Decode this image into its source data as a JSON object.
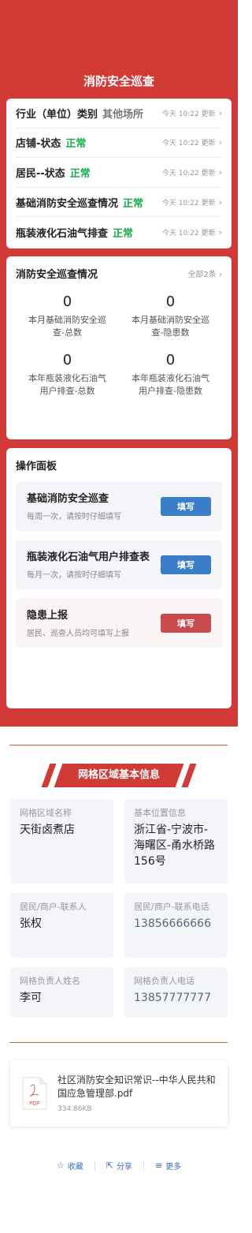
{
  "page_title": "消防安全巡查",
  "status_rows": [
    {
      "label": "行业（单位）类别",
      "value": "其他场所",
      "value_color": "gray",
      "updated": "今天 10:22 更新"
    },
    {
      "label": "店铺-状态",
      "value": "正常",
      "value_color": "green",
      "updated": "今天 10:22 更新"
    },
    {
      "label": "居民--状态",
      "value": "正常",
      "value_color": "green",
      "updated": "今天 10:22 更新"
    },
    {
      "label": "基础消防安全巡查情况",
      "value": "正常",
      "value_color": "green",
      "updated": "今天 10:22 更新"
    },
    {
      "label": "瓶装液化石油气排查",
      "value": "正常",
      "value_color": "green",
      "updated": "今天 10:22 更新"
    }
  ],
  "patrol": {
    "title": "消防安全巡查情况",
    "more": "全部2条",
    "stats": [
      {
        "value": "0",
        "label": "本月基础消防安全巡查-总数"
      },
      {
        "value": "0",
        "label": "本月基础消防安全巡查-隐患数"
      },
      {
        "value": "0",
        "label": "本年瓶装液化石油气用户排查-总数"
      },
      {
        "value": "0",
        "label": "本年瓶装液化石油气用户排查-隐患数"
      }
    ]
  },
  "ops": {
    "title": "操作面板",
    "items": [
      {
        "title": "基础消防安全巡查",
        "sub": "每周一次，请按时仔细填写",
        "button": "填写"
      },
      {
        "title": "瓶装液化石油气用户排查表",
        "sub": "每月一次，请按时仔细填写",
        "button": "填写"
      },
      {
        "title": "隐患上报",
        "sub": "居民、巡查人员均可填写上报",
        "button": "填写"
      }
    ]
  },
  "grid_info": {
    "banner": "网格区域基本信息",
    "fields": [
      {
        "key": "网格区域名称",
        "value": "天街卤煮店"
      },
      {
        "key": "基本位置信息",
        "value": "浙江省-宁波市-海曙区-甬水桥路156号"
      },
      {
        "key": "居民/商户-联系人",
        "value": "张权"
      },
      {
        "key": "居民/商户-联系电话",
        "value": "13856666666"
      },
      {
        "key": "网格负责人姓名",
        "value": "李可"
      },
      {
        "key": "网格负责人电话",
        "value": "13857777777"
      }
    ]
  },
  "file": {
    "icon_label": "PDF",
    "name": "社区消防安全知识常识--中华人民共和国应急管理部.pdf",
    "size": "334.86KB"
  },
  "bottom_bar": {
    "favorite": "收藏",
    "share": "分享",
    "more": "更多"
  },
  "colors": {
    "primary_red": "#d23a36",
    "status_green": "#1aad4e",
    "button_blue": "#3a7dc9",
    "button_red": "#c94c4c",
    "link_blue": "#3a6fc4"
  }
}
